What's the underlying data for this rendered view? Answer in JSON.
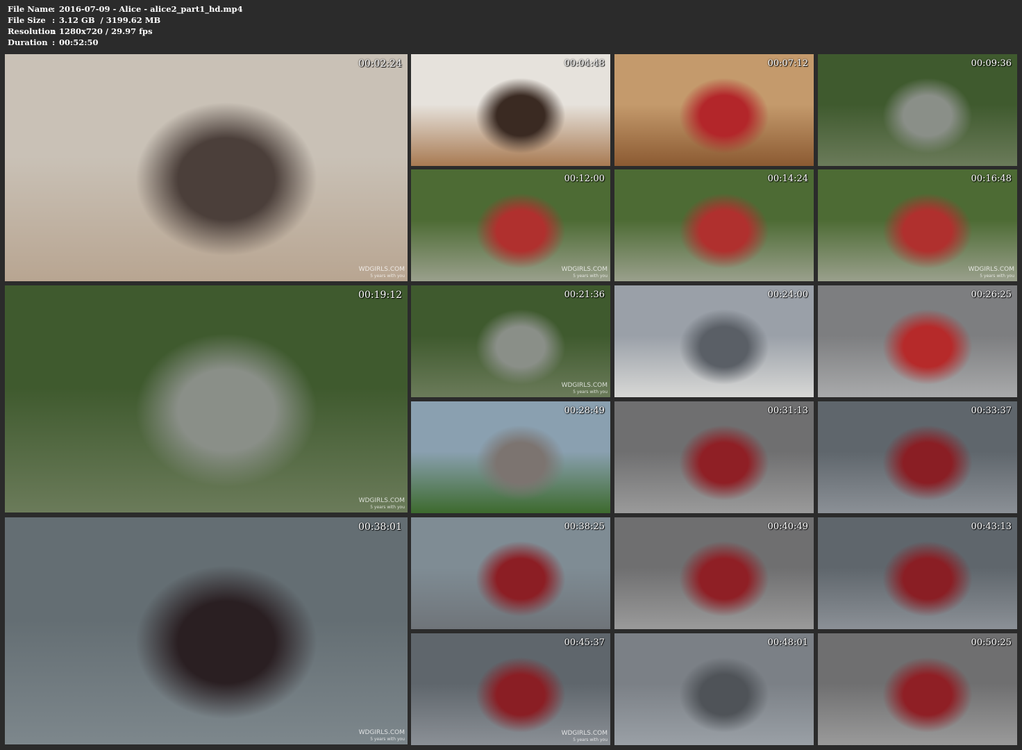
{
  "header": {
    "rows": [
      {
        "key": "File Name",
        "sep": ":",
        "value": "2016-07-09 - Alice - alice2_part1_hd.mp4"
      },
      {
        "key": "File Size",
        "sep": ":",
        "value": "3.12 GB  / 3199.62 MB"
      },
      {
        "key": "Resolution",
        "sep": ":",
        "value": "1280x720 / 29.97 fps"
      },
      {
        "key": "Duration",
        "sep": ":",
        "value": "00:52:50"
      }
    ]
  },
  "watermark": {
    "site": "WDGIRLS.COM",
    "tagline": "5 years with you"
  },
  "thumbnails": [
    {
      "time": "00:02:24",
      "scene": "bathroom",
      "watermark": true
    },
    {
      "time": "00:04:48",
      "scene": "bathroom-door",
      "watermark": false
    },
    {
      "time": "00:07:12",
      "scene": "wine-shop",
      "watermark": false
    },
    {
      "time": "00:09:36",
      "scene": "park-bench",
      "watermark": false
    },
    {
      "time": "00:12:00",
      "scene": "park",
      "watermark": true
    },
    {
      "time": "00:14:24",
      "scene": "park",
      "watermark": false
    },
    {
      "time": "00:16:48",
      "scene": "park",
      "watermark": true
    },
    {
      "time": "00:19:12",
      "scene": "park-bench",
      "watermark": true
    },
    {
      "time": "00:21:36",
      "scene": "park-bench",
      "watermark": true
    },
    {
      "time": "00:24:00",
      "scene": "street",
      "watermark": false
    },
    {
      "time": "00:26:25",
      "scene": "pavement",
      "watermark": false
    },
    {
      "time": "00:28:49",
      "scene": "riverside",
      "watermark": false
    },
    {
      "time": "00:31:13",
      "scene": "cobblestone",
      "watermark": false
    },
    {
      "time": "00:33:37",
      "scene": "river-edge",
      "watermark": false
    },
    {
      "time": "00:38:01",
      "scene": "river",
      "watermark": true
    },
    {
      "time": "00:38:25",
      "scene": "river-bridge",
      "watermark": false
    },
    {
      "time": "00:40:49",
      "scene": "cobblestone",
      "watermark": false
    },
    {
      "time": "00:43:13",
      "scene": "river-edge",
      "watermark": false
    },
    {
      "time": "00:45:37",
      "scene": "river-edge",
      "watermark": true
    },
    {
      "time": "00:48:01",
      "scene": "cobblestone-water",
      "watermark": false
    },
    {
      "time": "00:50:25",
      "scene": "cobblestone",
      "watermark": false
    }
  ]
}
